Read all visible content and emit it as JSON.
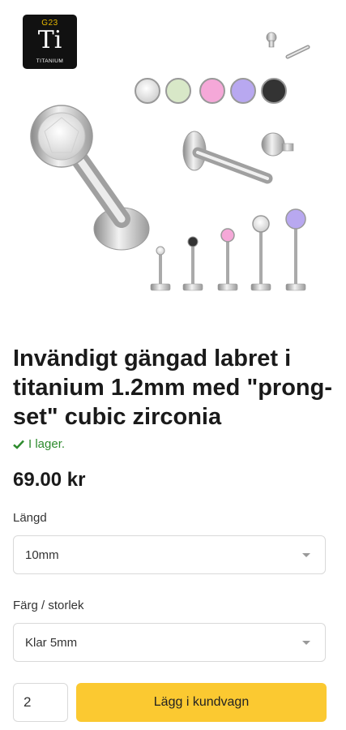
{
  "badge": {
    "grade": "G23",
    "symbol": "Ti",
    "name": "TITANIUM"
  },
  "product": {
    "title": "Invändigt gängad labret i titanium 1.2mm med \"prong-set\" cubic zirconia",
    "stock_icon": "check-icon",
    "stock": "I lager.",
    "price": "69.00 kr"
  },
  "options": {
    "length_label": "Längd",
    "length_value": "10mm",
    "color_label": "Färg / storlek",
    "color_value": "Klar 5mm"
  },
  "cart": {
    "quantity": "2",
    "button_label": "Lägg i kundvagn"
  },
  "colors": {
    "accent": "#fbc931",
    "stock": "#2e8b2e",
    "gems": [
      "#f0f0f0",
      "#d8e8c8",
      "#f5a8d8",
      "#b8a8f0",
      "#333333"
    ]
  }
}
